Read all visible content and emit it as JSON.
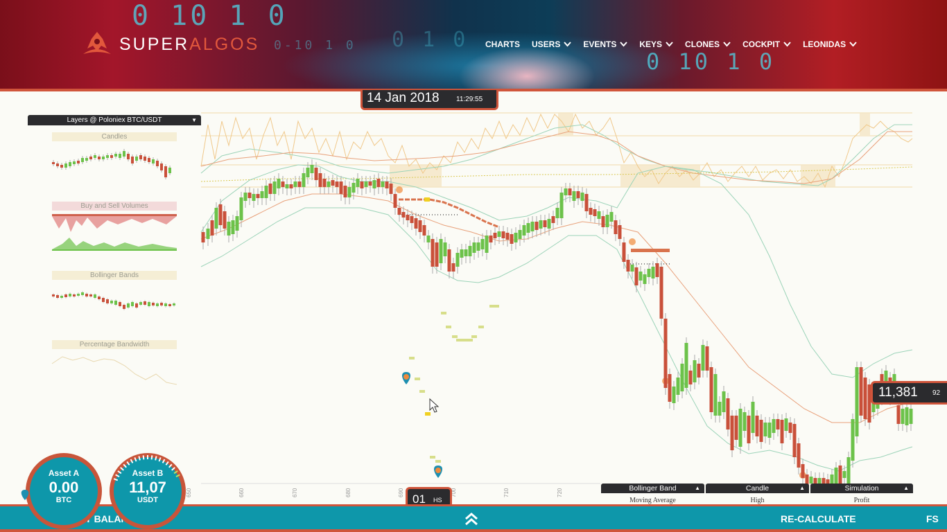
{
  "header": {
    "brand_left": "SUPER",
    "brand_right": "ALGOS",
    "code_rain": [
      "0 10 1 0",
      "0 10 1 0",
      "0-10 1 0",
      "0 1 0"
    ],
    "nav": [
      {
        "label": "CHARTS",
        "dropdown": false
      },
      {
        "label": "USERS",
        "dropdown": true
      },
      {
        "label": "EVENTS",
        "dropdown": true
      },
      {
        "label": "KEYS",
        "dropdown": true
      },
      {
        "label": "CLONES",
        "dropdown": true
      },
      {
        "label": "COCKPIT",
        "dropdown": true
      },
      {
        "label": "LEONIDAS",
        "dropdown": true
      }
    ]
  },
  "datetime": {
    "date": "14 Jan 2018",
    "time": "11:29:55"
  },
  "layers_panel": {
    "title": "Layers @ Poloniex BTC/USDT",
    "caret": "▼",
    "layers": [
      "Candles",
      "Buy and Sell Volumes",
      "Bollinger Bands",
      "Percentage Bandwidth"
    ]
  },
  "price": {
    "main": "11,381",
    "decimals": "92"
  },
  "time_period": {
    "value": "01",
    "unit": "HS"
  },
  "x_axis_ticks": [
    "650",
    "660",
    "670",
    "680",
    "690",
    "700",
    "710",
    "720"
  ],
  "bottom_panels": [
    {
      "title": "Bollinger Band",
      "arrow": "▲",
      "sub": "Moving Average"
    },
    {
      "title": "Candle",
      "arrow": "▲",
      "sub": "High"
    },
    {
      "title": "Simulation",
      "arrow": "▲",
      "sub": "Profit"
    }
  ],
  "gauges": [
    {
      "title": "Asset A",
      "value": "0.00",
      "unit": "BTC"
    },
    {
      "title": "Asset B",
      "value": "11,07",
      "unit": "USDT"
    }
  ],
  "footer": {
    "asset_balances": "ASSET BALANCES",
    "expand_icon": "double-chevron-up-icon",
    "recalculate": "RE-CALCULATE",
    "fullscreen": "FS"
  },
  "colors": {
    "accent": "#d0553b",
    "teal": "#0e97aa",
    "bull": "#6cc24a",
    "bear": "#c9503a",
    "dark_panel": "#2b2b2e"
  }
}
